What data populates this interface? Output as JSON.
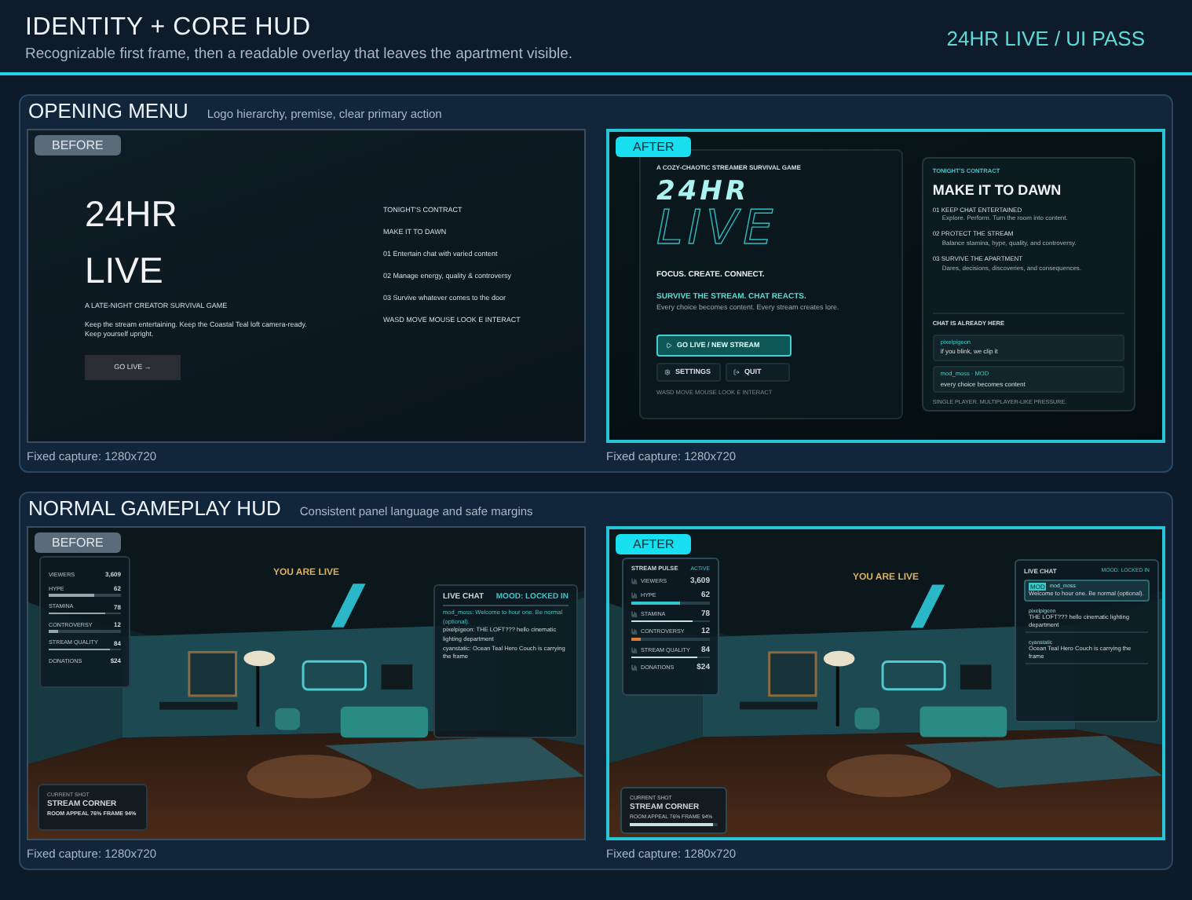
{
  "header": {
    "title": "IDENTITY + CORE HUD",
    "subtitle": "Recognizable first frame, then a readable overlay that leaves the apartment visible.",
    "badge": "24HR LIVE / UI PASS"
  },
  "sections": [
    {
      "title": "OPENING MENU",
      "note": "Logo hierarchy, premise, clear primary action",
      "frames": [
        {
          "tag": "BEFORE",
          "kind": "before",
          "caption": "Fixed capture: 1280x720",
          "screen": {
            "kind": "menu_before",
            "logo": [
              "24HR",
              "LIVE"
            ],
            "tagline": "A LATE-NIGHT CREATOR SURVIVAL GAME",
            "body": [
              "Keep the stream entertaining. Keep the Coastal Teal loft camera-ready.",
              "Keep yourself upright."
            ],
            "button": "GO LIVE →",
            "contract": [
              "TONIGHT'S CONTRACT",
              "MAKE IT TO DAWN",
              "01  Entertain chat with varied content",
              "02  Manage energy, quality & controversy",
              "03  Survive whatever comes to the door"
            ],
            "controls": "WASD MOVE   MOUSE LOOK   E INTERACT"
          }
        },
        {
          "tag": "AFTER",
          "kind": "after",
          "caption": "Fixed capture: 1280x720",
          "screen": {
            "kind": "menu_after",
            "kicker": "A COZY-CHAOTIC STREAMER SURVIVAL GAME",
            "logo": [
              "24HR",
              "LIVE"
            ],
            "motto": "FOCUS. CREATE. CONNECT.",
            "hook": "SURVIVE THE STREAM. CHAT REACTS.",
            "sub": "Every choice becomes content. Every stream creates lore.",
            "primary": "GO LIVE / NEW STREAM",
            "secondary": [
              {
                "kind": "settings",
                "label": "SETTINGS"
              },
              {
                "kind": "quit",
                "label": "QUIT"
              }
            ],
            "controls": "WASD MOVE   MOUSE LOOK   E INTERACT",
            "card": {
              "kicker": "TONIGHT'S CONTRACT",
              "title": "MAKE IT TO DAWN",
              "goals": [
                {
                  "title": "01  KEEP CHAT ENTERTAINED",
                  "desc": "Explore. Perform. Turn the room into content."
                },
                {
                  "title": "02  PROTECT THE STREAM",
                  "desc": "Balance stamina, hype, quality, and controversy."
                },
                {
                  "title": "03  SURVIVE THE APARTMENT",
                  "desc": "Dares, decisions, discoveries, and consequences."
                }
              ],
              "chat_title": "CHAT IS ALREADY HERE",
              "messages": [
                {
                  "user": "pixelpigeon",
                  "text": "if you blink, we clip it"
                },
                {
                  "user": "mod_moss · MOD",
                  "text": "every choice becomes content"
                }
              ],
              "footer": "SINGLE PLAYER. MULTIPLAYER-LIKE PRESSURE."
            }
          }
        }
      ]
    },
    {
      "title": "NORMAL GAMEPLAY HUD",
      "note": "Consistent panel language and safe margins",
      "frames": [
        {
          "tag": "BEFORE",
          "kind": "before",
          "caption": "Fixed capture: 1280x720",
          "screen": {
            "kind": "hud_before",
            "live": "YOU ARE LIVE",
            "stats": [
              {
                "label": "VIEWERS",
                "value": "3,609"
              },
              {
                "label": "HYPE",
                "value": "62",
                "level": 0.62
              },
              {
                "label": "STAMINA",
                "value": "78",
                "level": 0.78
              },
              {
                "label": "CONTROVERSY",
                "value": "12",
                "level": 0.12
              },
              {
                "label": "STREAM QUALITY",
                "value": "84",
                "level": 0.84
              },
              {
                "label": "DONATIONS",
                "value": "$24"
              }
            ],
            "chat": {
              "title": "LIVE CHAT",
              "mood": "MOOD: LOCKED IN",
              "lines": [
                {
                  "text": "mod_moss: Welcome to hour one. Be normal (optional).",
                  "highlight": true
                },
                {
                  "text": "pixelpigeon: THE LOFT??? hello cinematic lighting department",
                  "highlight": false
                },
                {
                  "text": "cyanstatic: Ocean Teal Hero Couch is carrying the frame",
                  "highlight": false
                }
              ]
            },
            "shot": {
              "label": "CURRENT SHOT",
              "title": "STREAM CORNER",
              "detail": "ROOM APPEAL 76%   FRAME 94%"
            }
          }
        },
        {
          "tag": "AFTER",
          "kind": "after",
          "caption": "Fixed capture: 1280x720",
          "screen": {
            "kind": "hud_after",
            "live": "YOU ARE LIVE",
            "panel_title": "STREAM PULSE",
            "panel_status": "ACTIVE",
            "stats": [
              {
                "label": "VIEWERS",
                "value": "3,609"
              },
              {
                "label": "HYPE",
                "value": "62",
                "level": 0.62,
                "color": "#2fc6d6"
              },
              {
                "label": "STAMINA",
                "value": "78",
                "level": 0.78,
                "color": "#c9dfe4"
              },
              {
                "label": "CONTROVERSY",
                "value": "12",
                "level": 0.12,
                "color": "#e07a3a"
              },
              {
                "label": "STREAM QUALITY",
                "value": "84",
                "level": 0.84,
                "color": "#c9dfe4"
              },
              {
                "label": "DONATIONS",
                "value": "$24"
              }
            ],
            "chat": {
              "title": "LIVE CHAT",
              "mood": "MOOD: LOCKED IN",
              "messages": [
                {
                  "user": "mod_moss",
                  "badge": "MOD",
                  "text": "Welcome to hour one. Be normal (optional).",
                  "highlight": true
                },
                {
                  "user": "pixelpigeon",
                  "text": "THE LOFT??? hello cinematic lighting department",
                  "highlight": false
                },
                {
                  "user": "cyanstatic",
                  "text": "Ocean Teal Hero Couch is carrying the frame",
                  "highlight": false
                }
              ]
            },
            "shot": {
              "label": "CURRENT SHOT",
              "title": "STREAM CORNER",
              "detail": "ROOM APPEAL 76%   FRAME 94%",
              "level": 0.94
            }
          }
        }
      ]
    }
  ]
}
